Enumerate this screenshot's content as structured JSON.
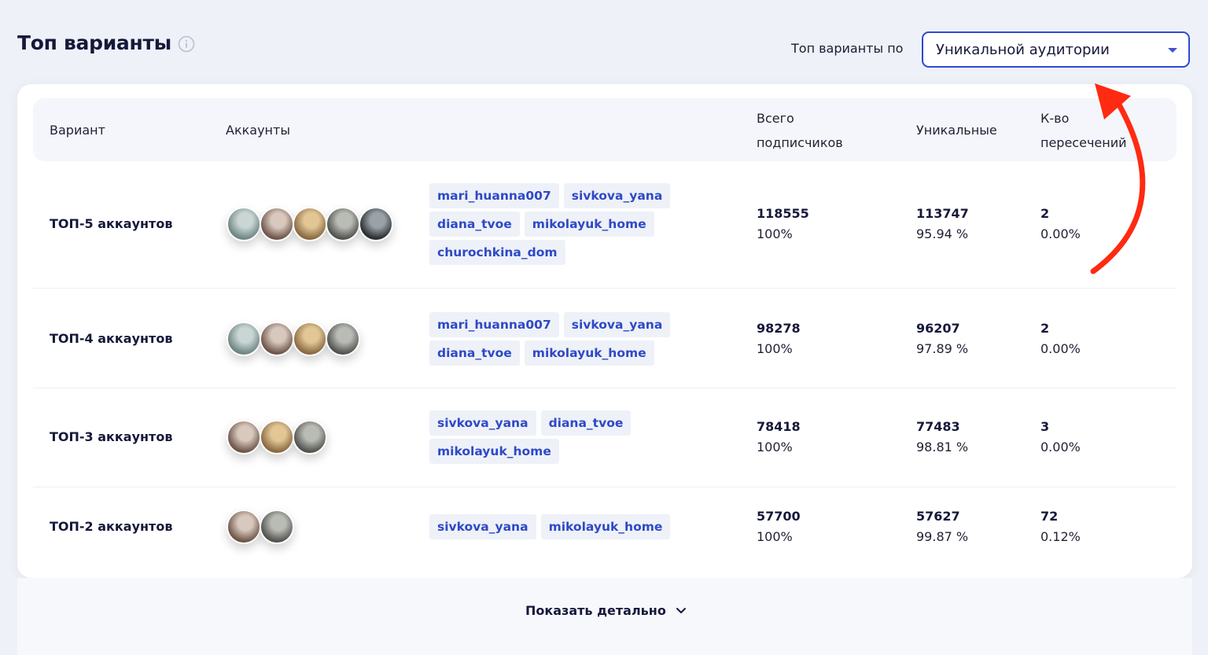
{
  "header": {
    "title": "Топ варианты",
    "filter_label": "Топ варианты по",
    "select_value": "Уникальной аудитории"
  },
  "table": {
    "columns": {
      "variant": "Вариант",
      "accounts": "Аккаунты",
      "total_line1": "Всего",
      "total_line2": "подписчиков",
      "unique": "Уникальные",
      "overlap_line1": "К-во",
      "overlap_line2": "пересечений"
    },
    "rows": [
      {
        "variant": "ТОП-5 аккаунтов",
        "avatars": 5,
        "tags": [
          "mari_huanna007",
          "sivkova_yana",
          "diana_tvoe",
          "mikolayuk_home",
          "churochkina_dom"
        ],
        "total": "118555",
        "total_pct": "100%",
        "unique": "113747",
        "unique_pct": "95.94 %",
        "overlap": "2",
        "overlap_pct": "0.00%"
      },
      {
        "variant": "ТОП-4 аккаунтов",
        "avatars": 4,
        "tags": [
          "mari_huanna007",
          "sivkova_yana",
          "diana_tvoe",
          "mikolayuk_home"
        ],
        "total": "98278",
        "total_pct": "100%",
        "unique": "96207",
        "unique_pct": "97.89 %",
        "overlap": "2",
        "overlap_pct": "0.00%"
      },
      {
        "variant": "ТОП-3 аккаунтов",
        "avatars": 3,
        "tags": [
          "sivkova_yana",
          "diana_tvoe",
          "mikolayuk_home"
        ],
        "total": "78418",
        "total_pct": "100%",
        "unique": "77483",
        "unique_pct": "98.81 %",
        "overlap": "3",
        "overlap_pct": "0.00%"
      },
      {
        "variant": "ТОП-2 аккаунтов",
        "avatars": 2,
        "tags": [
          "sivkova_yana",
          "mikolayuk_home"
        ],
        "total": "57700",
        "total_pct": "100%",
        "unique": "57627",
        "unique_pct": "99.87 %",
        "overlap": "72",
        "overlap_pct": "0.12%"
      }
    ]
  },
  "footer": {
    "show_more": "Показать детально"
  },
  "colors": {
    "accent": "#2f49d1",
    "tag_bg": "#eef1f8",
    "tag_text": "#2e49c6",
    "annotation_arrow": "#ff2a12"
  }
}
